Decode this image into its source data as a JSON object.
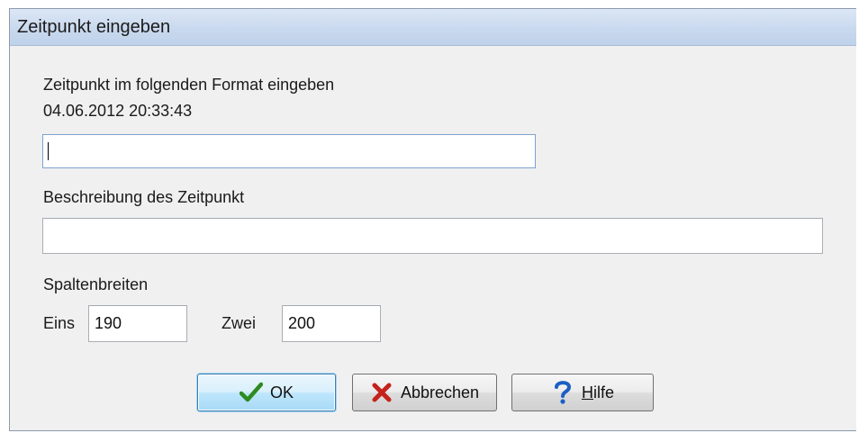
{
  "window": {
    "title": "Zeitpunkt eingeben"
  },
  "form": {
    "prompt_label": "Zeitpunkt im folgenden Format eingeben",
    "format_example": "04.06.2012 20:33:43",
    "timestamp_value": "",
    "description_label": "Beschreibung des Zeitpunkt",
    "description_value": "",
    "column_widths_label": "Spaltenbreiten",
    "col1_label": "Eins",
    "col1_value": "190",
    "col2_label": "Zwei",
    "col2_value": "200"
  },
  "buttons": {
    "ok_label": "OK",
    "cancel_label": "Abbrechen",
    "help_label_first": "H",
    "help_label_rest": "ilfe",
    "ok_icon": "checkmark-icon",
    "cancel_icon": "x-icon",
    "help_icon": "question-icon"
  },
  "colors": {
    "title_bar": "#c9d9ee",
    "dialog_bg": "#f0f0f0",
    "check_green": "#2e8b1f",
    "x_red": "#c4221c",
    "question_blue": "#1c5fc4"
  }
}
